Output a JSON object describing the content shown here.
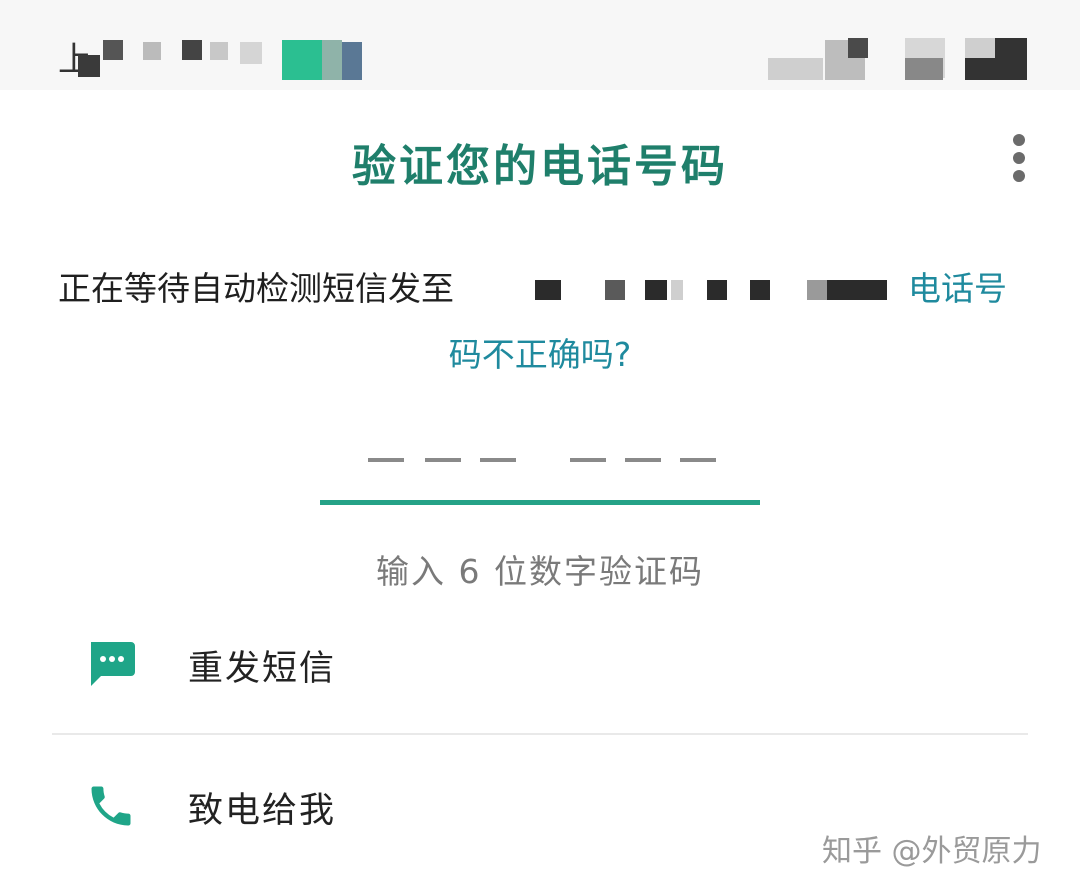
{
  "status_bar": {
    "carrier_fragment": "上"
  },
  "header": {
    "title": "验证您的电话号码",
    "menu_icon": "more-vert-icon"
  },
  "instruction": {
    "text": "正在等待自动检测短信发至",
    "wrong_number_link_part1": "电话号",
    "wrong_number_link_part2": "码不正确吗?"
  },
  "code_input": {
    "slots": 6,
    "hint": "输入 6 位数字验证码"
  },
  "options": [
    {
      "label": "重发短信",
      "icon": "sms-icon"
    },
    {
      "label": "致电给我",
      "icon": "phone-icon"
    }
  ],
  "watermark": "知乎 @外贸原力",
  "colors": {
    "accent": "#1f7f6b",
    "link": "#1f8a9e",
    "underline": "#25a287",
    "icon": "#1fa588"
  }
}
